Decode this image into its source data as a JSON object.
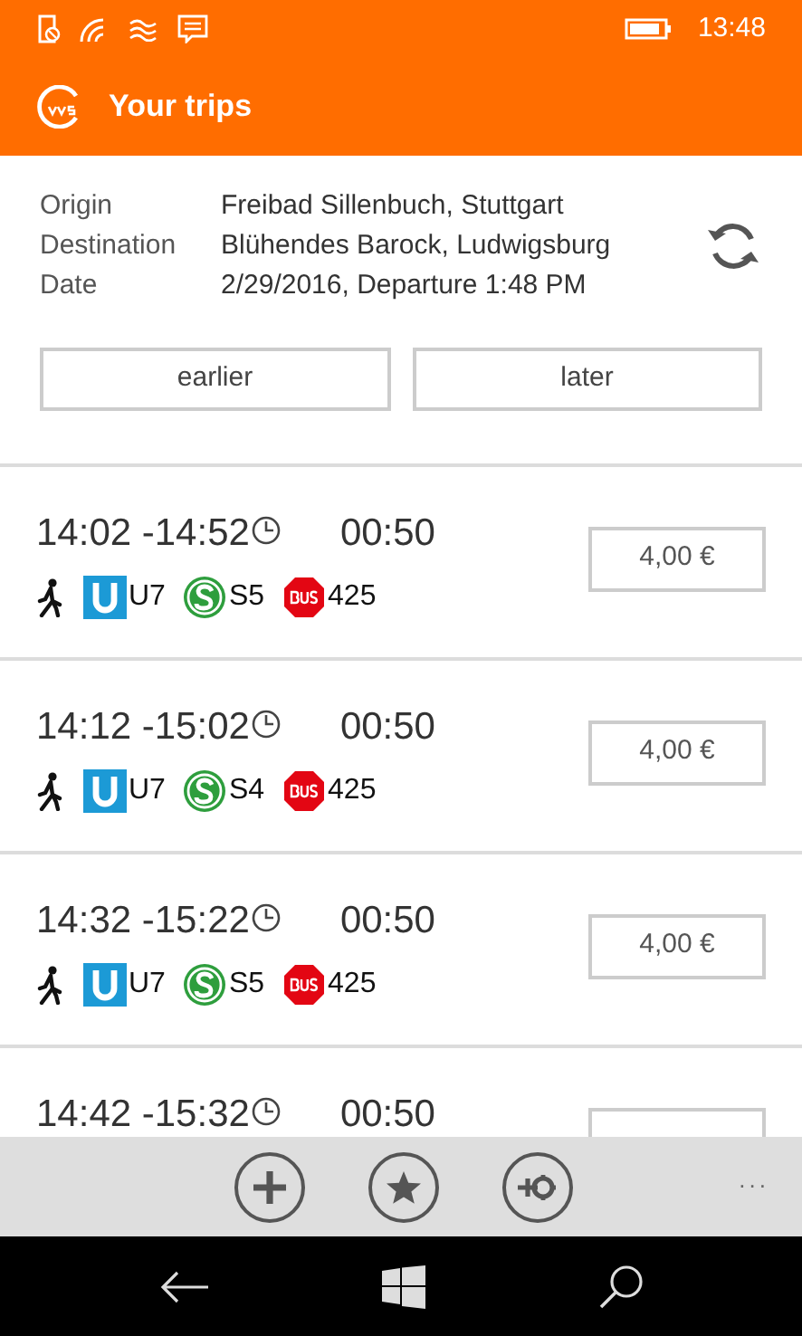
{
  "status_bar": {
    "time": "13:48"
  },
  "header": {
    "title": "Your trips"
  },
  "query": {
    "rows": [
      {
        "label": "Origin",
        "value": "Freibad Sillenbuch, Stuttgart"
      },
      {
        "label": "Destination",
        "value": "Blühendes Barock, Ludwigsburg"
      },
      {
        "label": "Date",
        "value": "2/29/2016, Departure 1:48 PM"
      }
    ]
  },
  "paging_buttons": [
    "earlier",
    "later"
  ],
  "trips": [
    {
      "times": "14:02 -14:52",
      "duration": "00:50",
      "price": "4,00 €",
      "legs": [
        {
          "kind": "walk"
        },
        {
          "kind": "ubahn",
          "line": "U7"
        },
        {
          "kind": "sbahn",
          "line": "S5"
        },
        {
          "kind": "bus",
          "line": "425"
        }
      ]
    },
    {
      "times": "14:12 -15:02",
      "duration": "00:50",
      "price": "4,00 €",
      "legs": [
        {
          "kind": "walk"
        },
        {
          "kind": "ubahn",
          "line": "U7"
        },
        {
          "kind": "sbahn",
          "line": "S4"
        },
        {
          "kind": "bus",
          "line": "425"
        }
      ]
    },
    {
      "times": "14:32 -15:22",
      "duration": "00:50",
      "price": "4,00 €",
      "legs": [
        {
          "kind": "walk"
        },
        {
          "kind": "ubahn",
          "line": "U7"
        },
        {
          "kind": "sbahn",
          "line": "S5"
        },
        {
          "kind": "bus",
          "line": "425"
        }
      ]
    },
    {
      "times": "14:42 -15:32",
      "duration": "00:50"
    }
  ],
  "app_bar": {
    "more": "..."
  }
}
